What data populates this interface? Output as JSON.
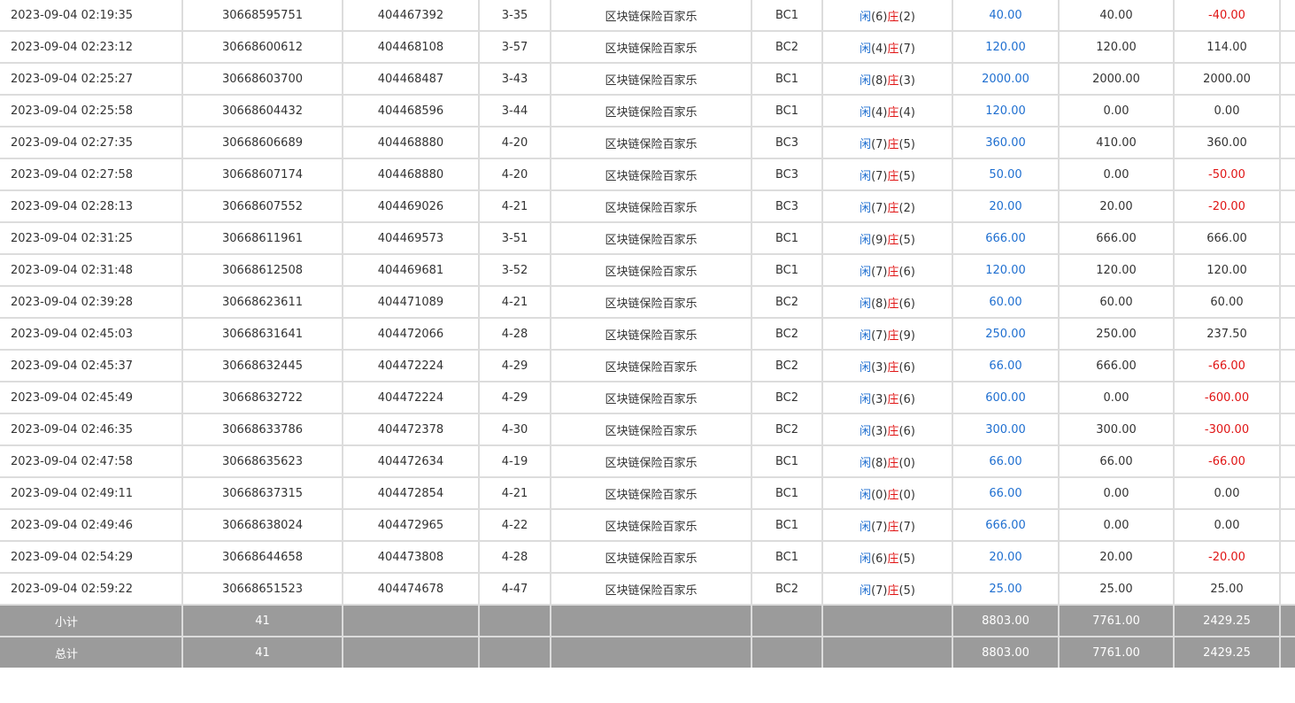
{
  "rows": [
    {
      "time": "2023-09-04 02:19:35",
      "order": "30668595751",
      "round": "404467392",
      "shoe": "3-35",
      "game": "区块链保险百家乐",
      "table": "BC1",
      "xian_label": "闲",
      "xian": "(6)",
      "zhuang_label": "庄",
      "zhuang": "(2)",
      "bet": "40.00",
      "valid": "40.00",
      "win": "-40.00",
      "win_color": "red"
    },
    {
      "time": "2023-09-04 02:23:12",
      "order": "30668600612",
      "round": "404468108",
      "shoe": "3-57",
      "game": "区块链保险百家乐",
      "table": "BC2",
      "xian_label": "闲",
      "xian": "(4)",
      "zhuang_label": "庄",
      "zhuang": "(7)",
      "bet": "120.00",
      "valid": "120.00",
      "win": "114.00",
      "win_color": "black"
    },
    {
      "time": "2023-09-04 02:25:27",
      "order": "30668603700",
      "round": "404468487",
      "shoe": "3-43",
      "game": "区块链保险百家乐",
      "table": "BC1",
      "xian_label": "闲",
      "xian": "(8)",
      "zhuang_label": "庄",
      "zhuang": "(3)",
      "bet": "2000.00",
      "valid": "2000.00",
      "win": "2000.00",
      "win_color": "black"
    },
    {
      "time": "2023-09-04 02:25:58",
      "order": "30668604432",
      "round": "404468596",
      "shoe": "3-44",
      "game": "区块链保险百家乐",
      "table": "BC1",
      "xian_label": "闲",
      "xian": "(4)",
      "zhuang_label": "庄",
      "zhuang": "(4)",
      "bet": "120.00",
      "valid": "0.00",
      "win": "0.00",
      "win_color": "black"
    },
    {
      "time": "2023-09-04 02:27:35",
      "order": "30668606689",
      "round": "404468880",
      "shoe": "4-20",
      "game": "区块链保险百家乐",
      "table": "BC3",
      "xian_label": "闲",
      "xian": "(7)",
      "zhuang_label": "庄",
      "zhuang": "(5)",
      "bet": "360.00",
      "valid": "410.00",
      "win": "360.00",
      "win_color": "black"
    },
    {
      "time": "2023-09-04 02:27:58",
      "order": "30668607174",
      "round": "404468880",
      "shoe": "4-20",
      "game": "区块链保险百家乐",
      "table": "BC3",
      "xian_label": "闲",
      "xian": "(7)",
      "zhuang_label": "庄",
      "zhuang": "(5)",
      "bet": "50.00",
      "valid": "0.00",
      "win": "-50.00",
      "win_color": "red"
    },
    {
      "time": "2023-09-04 02:28:13",
      "order": "30668607552",
      "round": "404469026",
      "shoe": "4-21",
      "game": "区块链保险百家乐",
      "table": "BC3",
      "xian_label": "闲",
      "xian": "(7)",
      "zhuang_label": "庄",
      "zhuang": "(2)",
      "bet": "20.00",
      "valid": "20.00",
      "win": "-20.00",
      "win_color": "red"
    },
    {
      "time": "2023-09-04 02:31:25",
      "order": "30668611961",
      "round": "404469573",
      "shoe": "3-51",
      "game": "区块链保险百家乐",
      "table": "BC1",
      "xian_label": "闲",
      "xian": "(9)",
      "zhuang_label": "庄",
      "zhuang": "(5)",
      "bet": "666.00",
      "valid": "666.00",
      "win": "666.00",
      "win_color": "black"
    },
    {
      "time": "2023-09-04 02:31:48",
      "order": "30668612508",
      "round": "404469681",
      "shoe": "3-52",
      "game": "区块链保险百家乐",
      "table": "BC1",
      "xian_label": "闲",
      "xian": "(7)",
      "zhuang_label": "庄",
      "zhuang": "(6)",
      "bet": "120.00",
      "valid": "120.00",
      "win": "120.00",
      "win_color": "black"
    },
    {
      "time": "2023-09-04 02:39:28",
      "order": "30668623611",
      "round": "404471089",
      "shoe": "4-21",
      "game": "区块链保险百家乐",
      "table": "BC2",
      "xian_label": "闲",
      "xian": "(8)",
      "zhuang_label": "庄",
      "zhuang": "(6)",
      "bet": "60.00",
      "valid": "60.00",
      "win": "60.00",
      "win_color": "black"
    },
    {
      "time": "2023-09-04 02:45:03",
      "order": "30668631641",
      "round": "404472066",
      "shoe": "4-28",
      "game": "区块链保险百家乐",
      "table": "BC2",
      "xian_label": "闲",
      "xian": "(7)",
      "zhuang_label": "庄",
      "zhuang": "(9)",
      "bet": "250.00",
      "valid": "250.00",
      "win": "237.50",
      "win_color": "black"
    },
    {
      "time": "2023-09-04 02:45:37",
      "order": "30668632445",
      "round": "404472224",
      "shoe": "4-29",
      "game": "区块链保险百家乐",
      "table": "BC2",
      "xian_label": "闲",
      "xian": "(3)",
      "zhuang_label": "庄",
      "zhuang": "(6)",
      "bet": "66.00",
      "valid": "666.00",
      "win": "-66.00",
      "win_color": "red"
    },
    {
      "time": "2023-09-04 02:45:49",
      "order": "30668632722",
      "round": "404472224",
      "shoe": "4-29",
      "game": "区块链保险百家乐",
      "table": "BC2",
      "xian_label": "闲",
      "xian": "(3)",
      "zhuang_label": "庄",
      "zhuang": "(6)",
      "bet": "600.00",
      "valid": "0.00",
      "win": "-600.00",
      "win_color": "red"
    },
    {
      "time": "2023-09-04 02:46:35",
      "order": "30668633786",
      "round": "404472378",
      "shoe": "4-30",
      "game": "区块链保险百家乐",
      "table": "BC2",
      "xian_label": "闲",
      "xian": "(3)",
      "zhuang_label": "庄",
      "zhuang": "(6)",
      "bet": "300.00",
      "valid": "300.00",
      "win": "-300.00",
      "win_color": "red"
    },
    {
      "time": "2023-09-04 02:47:58",
      "order": "30668635623",
      "round": "404472634",
      "shoe": "4-19",
      "game": "区块链保险百家乐",
      "table": "BC1",
      "xian_label": "闲",
      "xian": "(8)",
      "zhuang_label": "庄",
      "zhuang": "(0)",
      "bet": "66.00",
      "valid": "66.00",
      "win": "-66.00",
      "win_color": "red"
    },
    {
      "time": "2023-09-04 02:49:11",
      "order": "30668637315",
      "round": "404472854",
      "shoe": "4-21",
      "game": "区块链保险百家乐",
      "table": "BC1",
      "xian_label": "闲",
      "xian": "(0)",
      "zhuang_label": "庄",
      "zhuang": "(0)",
      "bet": "66.00",
      "valid": "0.00",
      "win": "0.00",
      "win_color": "black"
    },
    {
      "time": "2023-09-04 02:49:46",
      "order": "30668638024",
      "round": "404472965",
      "shoe": "4-22",
      "game": "区块链保险百家乐",
      "table": "BC1",
      "xian_label": "闲",
      "xian": "(7)",
      "zhuang_label": "庄",
      "zhuang": "(7)",
      "bet": "666.00",
      "valid": "0.00",
      "win": "0.00",
      "win_color": "black"
    },
    {
      "time": "2023-09-04 02:54:29",
      "order": "30668644658",
      "round": "404473808",
      "shoe": "4-28",
      "game": "区块链保险百家乐",
      "table": "BC1",
      "xian_label": "闲",
      "xian": "(6)",
      "zhuang_label": "庄",
      "zhuang": "(5)",
      "bet": "20.00",
      "valid": "20.00",
      "win": "-20.00",
      "win_color": "red"
    },
    {
      "time": "2023-09-04 02:59:22",
      "order": "30668651523",
      "round": "404474678",
      "shoe": "4-47",
      "game": "区块链保险百家乐",
      "table": "BC2",
      "xian_label": "闲",
      "xian": "(7)",
      "zhuang_label": "庄",
      "zhuang": "(5)",
      "bet": "25.00",
      "valid": "25.00",
      "win": "25.00",
      "win_color": "black"
    }
  ],
  "subtotal": {
    "label": "小计",
    "count": "41",
    "bet": "8803.00",
    "valid": "7761.00",
    "win": "2429.25"
  },
  "total": {
    "label": "总计",
    "count": "41",
    "bet": "8803.00",
    "valid": "7761.00",
    "win": "2429.25"
  },
  "colors": {
    "positive_bet": "#1f6fd0",
    "negative_win": "#e01515",
    "summary_bg": "#9b9b9b",
    "grid": "#dcdcdc"
  }
}
